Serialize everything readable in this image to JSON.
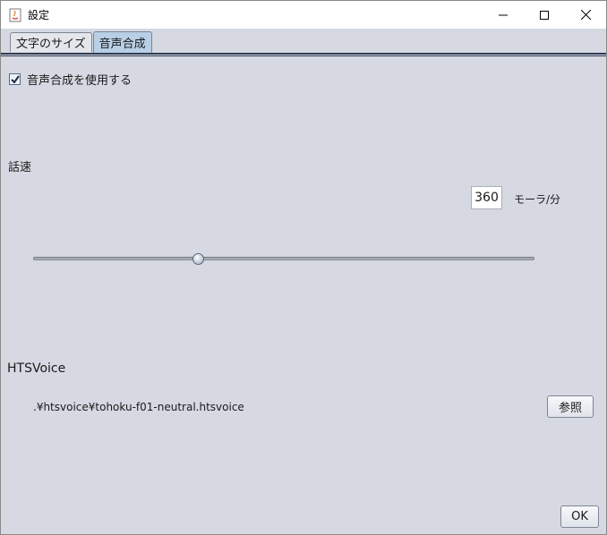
{
  "window": {
    "title": "設定",
    "controls": [
      "minimize-icon",
      "maximize-icon",
      "close-icon"
    ]
  },
  "tabs": [
    {
      "label": "文字のサイズ",
      "active": false
    },
    {
      "label": "音声合成",
      "active": true
    }
  ],
  "synthesis": {
    "enable_label": "音声合成を使用する",
    "enable_checked": true,
    "speed_label": "話速",
    "rate_value": "360",
    "rate_unit": "モーラ/分",
    "slider_fraction": 0.33,
    "hts_label": "HTSVoice",
    "hts_path": ".¥htsvoice¥tohoku-f01-neutral.htsvoice",
    "browse_label": "参照"
  },
  "footer": {
    "ok_label": "OK"
  },
  "colors": {
    "background": "#d6d9e2",
    "active_tab": "#b8cfe5",
    "tab_line": "#2e3a52"
  }
}
